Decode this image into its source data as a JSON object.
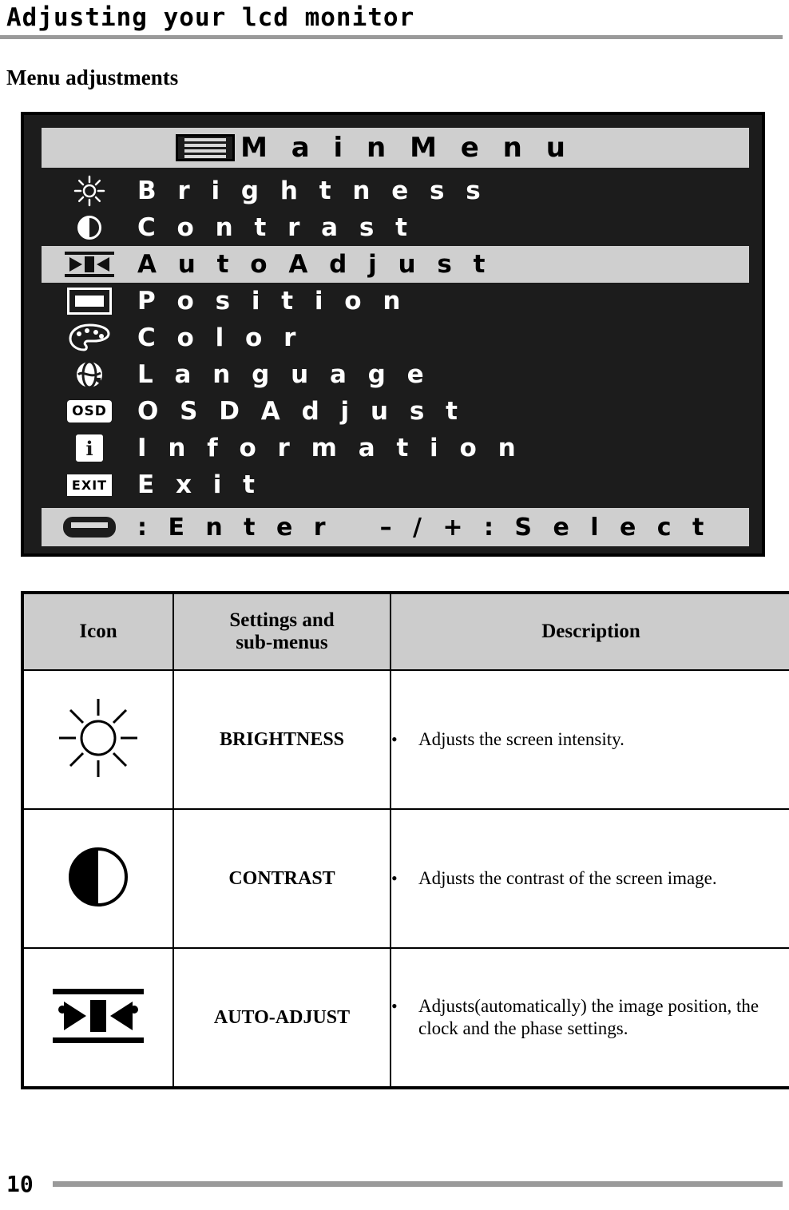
{
  "header": {
    "title": "Adjusting your lcd monitor"
  },
  "section": {
    "title": "Menu adjustments"
  },
  "osd": {
    "title": "M a i n   M e n u",
    "title_icon": "menu-lines-icon",
    "items": [
      {
        "label": "B r i g h t n e s s",
        "icon": "brightness-sun-icon",
        "highlighted": false
      },
      {
        "label": "C o n t r a s t",
        "icon": "contrast-half-circle-icon",
        "highlighted": false
      },
      {
        "label": "A u t o  A d j u s t",
        "icon": "auto-adjust-icon",
        "highlighted": true
      },
      {
        "label": "P o s i t i o n",
        "icon": "position-rectangle-icon",
        "highlighted": false
      },
      {
        "label": "C o l o r",
        "icon": "color-palette-icon",
        "highlighted": false
      },
      {
        "label": "L a n g u a g e",
        "icon": "language-globe-icon",
        "highlighted": false
      },
      {
        "label": "O S D  A d j u s t",
        "icon": "osd-badge-icon",
        "highlighted": false
      },
      {
        "label": "I n f o r m a t i o n",
        "icon": "information-icon",
        "highlighted": false
      },
      {
        "label": "E x i t",
        "icon": "exit-badge-icon",
        "highlighted": false
      }
    ],
    "footer": {
      "icon": "enter-key-icon",
      "enter_label": ": E n t e r",
      "select_label": "– / + : S e l e c t"
    }
  },
  "table": {
    "headers": {
      "icon": "Icon",
      "settings": "Settings and sub-menus",
      "settings_line1": "Settings and",
      "settings_line2": "sub-menus",
      "description": "Description"
    },
    "rows": [
      {
        "icon": "brightness-sun-icon",
        "setting": "BRIGHTNESS",
        "bullets": [
          "Adjusts the screen intensity."
        ]
      },
      {
        "icon": "contrast-half-circle-icon",
        "setting": "CONTRAST",
        "bullets": [
          "Adjusts the contrast of the screen image."
        ]
      },
      {
        "icon": "auto-adjust-icon",
        "setting": "AUTO-ADJUST",
        "bullets": [
          "Adjusts(automatically) the image position, the clock and the phase settings."
        ]
      }
    ],
    "bullet_glyph": "•"
  },
  "footer": {
    "page_number": "10"
  },
  "colors": {
    "rule": "#9a9a9a",
    "osd_background": "#1c1c1c",
    "osd_highlight": "#cfcfcf",
    "table_header": "#cccccc"
  }
}
